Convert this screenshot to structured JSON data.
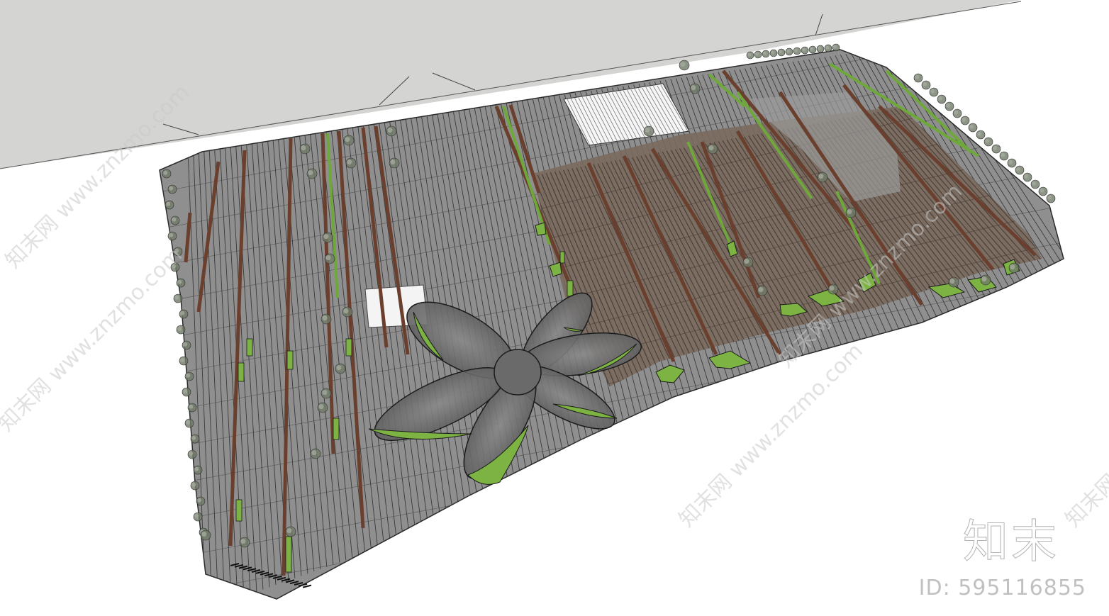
{
  "scene": {
    "description_kind": "3d-landscape-model-render",
    "colors": {
      "background": "#ffffff",
      "road": "#d4d4d2",
      "paving": "#8f8f8f",
      "wood_deck": "#7a6a5e",
      "planting": "#7cb342",
      "stripe": "#2b2b2b",
      "flower_canopy": "#6f6f6f"
    }
  },
  "watermarks": {
    "site_text": "知末网 www.znzmo.com",
    "logo_text": "知末",
    "id_text": "ID: 595116855"
  }
}
